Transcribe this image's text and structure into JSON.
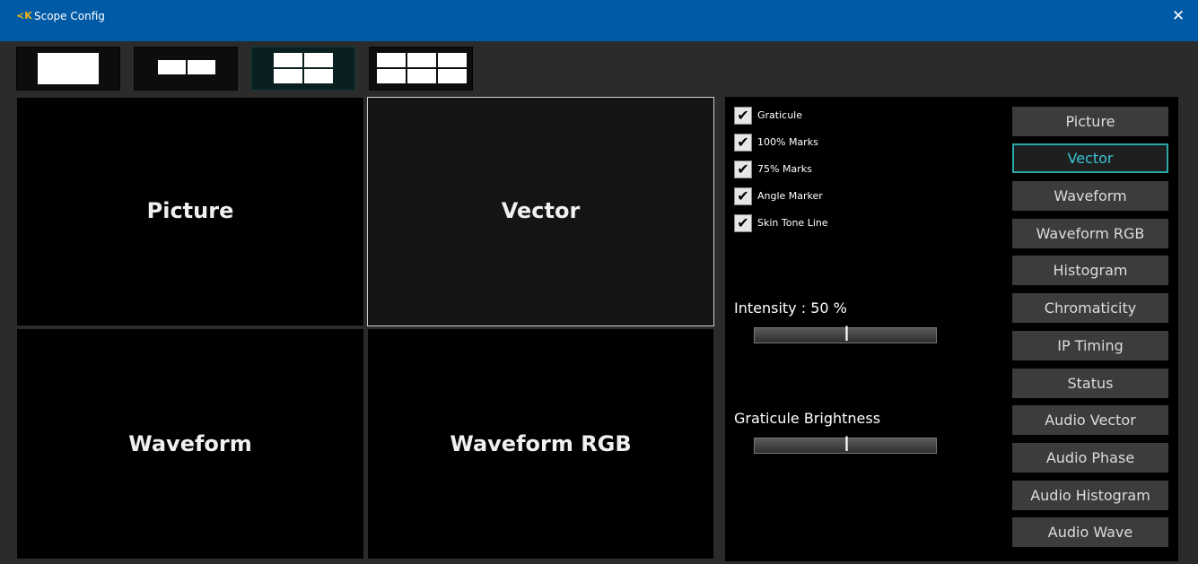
{
  "window": {
    "title": "Scope Config",
    "close_glyph": "✕",
    "icon_glyph": "≺K"
  },
  "layout_buttons": [
    {
      "name": "single",
      "cells": 1,
      "active": false
    },
    {
      "name": "dual",
      "cells": 2,
      "active": false
    },
    {
      "name": "quad-2x2",
      "cells": 4,
      "active": true
    },
    {
      "name": "six-3x2",
      "cells": 6,
      "active": false
    }
  ],
  "panes": [
    {
      "label": "Picture",
      "selected": false
    },
    {
      "label": "Vector",
      "selected": true
    },
    {
      "label": "Waveform",
      "selected": false
    },
    {
      "label": "Waveform RGB",
      "selected": false
    }
  ],
  "options": [
    {
      "label": "Graticule",
      "checked": true
    },
    {
      "label": "100% Marks",
      "checked": true
    },
    {
      "label": "75% Marks",
      "checked": true
    },
    {
      "label": "Angle Marker",
      "checked": true
    },
    {
      "label": "Skin Tone Line",
      "checked": true
    }
  ],
  "check_glyph": "✔",
  "sliders": {
    "intensity": {
      "label": "Intensity : 50 %",
      "value_percent": 50
    },
    "graticule_brightness": {
      "label": "Graticule Brightness",
      "value_percent": 50
    }
  },
  "slider_thumb_glyph": "I",
  "scope_types": [
    {
      "label": "Picture",
      "active": false
    },
    {
      "label": "Vector",
      "active": true
    },
    {
      "label": "Waveform",
      "active": false
    },
    {
      "label": "Waveform RGB",
      "active": false
    },
    {
      "label": "Histogram",
      "active": false
    },
    {
      "label": "Chromaticity",
      "active": false
    },
    {
      "label": "IP Timing",
      "active": false
    },
    {
      "label": "Status",
      "active": false
    },
    {
      "label": "Audio Vector",
      "active": false
    },
    {
      "label": "Audio Phase",
      "active": false
    },
    {
      "label": "Audio Histogram",
      "active": false
    },
    {
      "label": "Audio Wave",
      "active": false
    }
  ],
  "colors": {
    "titlebar": "#005aa6",
    "accent": "#2aa8a8",
    "active_text": "#38c6d6"
  }
}
